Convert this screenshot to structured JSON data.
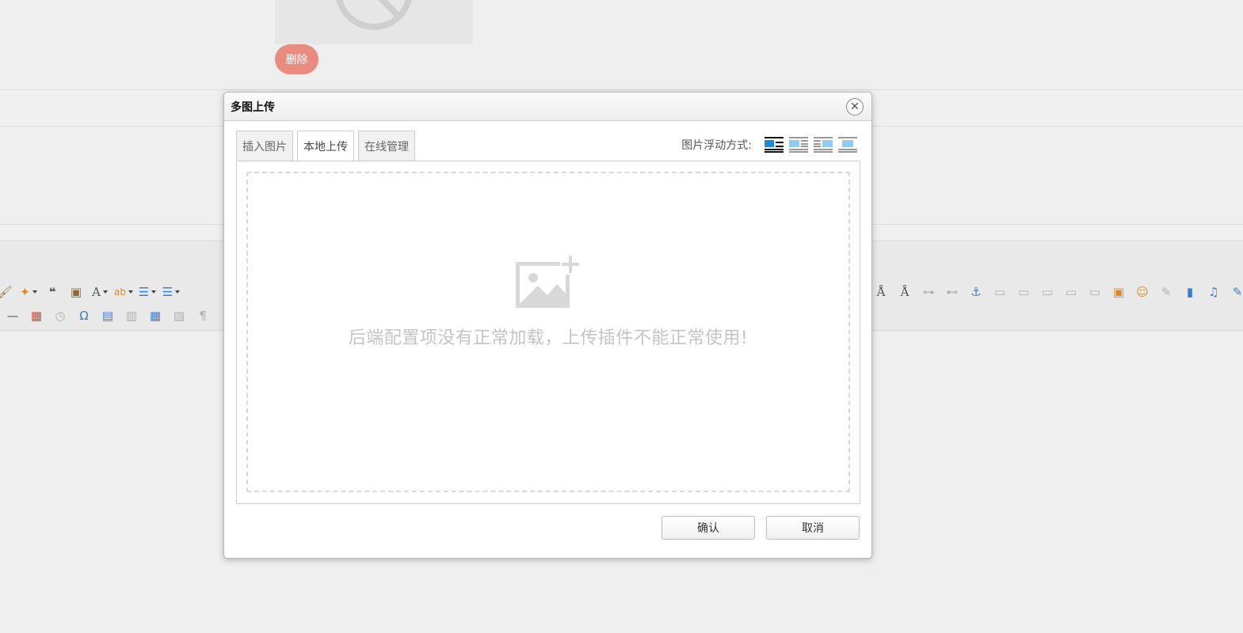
{
  "background": {
    "delete_label": "删除"
  },
  "dialog": {
    "title": "多图上传",
    "close_symbol": "✕",
    "tabs": [
      {
        "label": "插入图片",
        "active": false
      },
      {
        "label": "本地上传",
        "active": true
      },
      {
        "label": "在线管理",
        "active": false
      }
    ],
    "align_label": "图片浮动方式:",
    "align_options": [
      "float-none",
      "float-left",
      "float-right",
      "center"
    ],
    "upload_message": "后端配置项没有正常加载，上传插件不能正常使用!",
    "confirm_label": "确认",
    "cancel_label": "取消"
  },
  "colors": {
    "delete_button": "#e98b7e",
    "active_align": "#1a8bd6",
    "placeholder": "#c4c4c4"
  }
}
